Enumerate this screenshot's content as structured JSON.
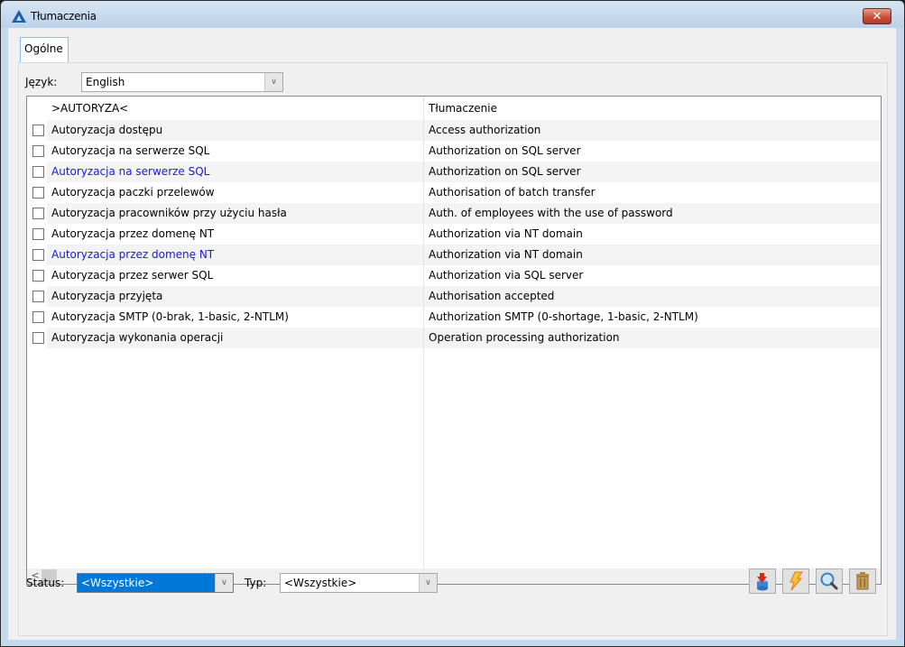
{
  "window": {
    "title": "Tłumaczenia",
    "close_label": "✕"
  },
  "tabs": [
    {
      "label": "Ogólne",
      "active": true
    }
  ],
  "language": {
    "label": "Język:",
    "selected": "English"
  },
  "grid": {
    "columns": [
      ">AUTORYZA<",
      "Tłumaczenie"
    ],
    "rows": [
      {
        "source": "Autoryzacja dostępu",
        "translation": "Access authorization",
        "checked": false,
        "highlight": false
      },
      {
        "source": "Autoryzacja na serwerze SQL",
        "translation": "Authorization on SQL server",
        "checked": false,
        "highlight": false
      },
      {
        "source": "Autoryzacja na serwerze SQL",
        "translation": "Authorization on SQL server",
        "checked": false,
        "highlight": true
      },
      {
        "source": "Autoryzacja paczki przelewów",
        "translation": "Authorisation of batch transfer",
        "checked": false,
        "highlight": false
      },
      {
        "source": "Autoryzacja pracowników przy użyciu hasła",
        "translation": "Auth. of employees with the use of password",
        "checked": false,
        "highlight": false
      },
      {
        "source": "Autoryzacja przez domenę NT",
        "translation": "Authorization via NT domain",
        "checked": false,
        "highlight": false
      },
      {
        "source": "Autoryzacja przez domenę NT",
        "translation": "Authorization via NT domain",
        "checked": false,
        "highlight": true
      },
      {
        "source": "Autoryzacja przez serwer SQL",
        "translation": "Authorization via SQL server",
        "checked": false,
        "highlight": false
      },
      {
        "source": "Autoryzacja przyjęta",
        "translation": "Authorisation accepted",
        "checked": false,
        "highlight": false
      },
      {
        "source": "Autoryzacja SMTP (0-brak, 1-basic, 2-NTLM)",
        "translation": "Authorization SMTP (0-shortage, 1-basic, 2-NTLM)",
        "checked": false,
        "highlight": false
      },
      {
        "source": "Autoryzacja wykonania operacji",
        "translation": "Operation processing authorization",
        "checked": false,
        "highlight": false
      }
    ],
    "scroll_left": "<",
    "scroll_right": ">"
  },
  "filters": {
    "status_label": "Status:",
    "status_value": "<Wszystkie>",
    "typ_label": "Typ:",
    "typ_value": "<Wszystkie>"
  },
  "toolbar": [
    {
      "name": "import-button",
      "icon": "database-import-icon"
    },
    {
      "name": "execute-button",
      "icon": "lightning-icon"
    },
    {
      "name": "search-button",
      "icon": "magnifier-icon"
    },
    {
      "name": "delete-button",
      "icon": "trash-icon"
    }
  ],
  "colors": {
    "highlight_text": "#1a1ad8",
    "selection": "#0078d7",
    "close_button": "#c9503b"
  }
}
